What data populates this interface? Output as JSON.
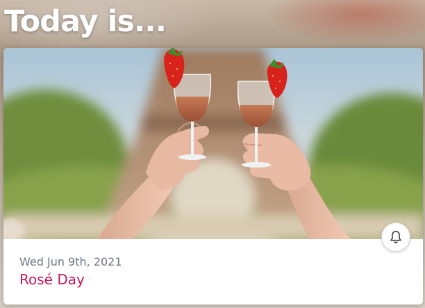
{
  "header": {
    "title": "Today is..."
  },
  "event_card": {
    "date": "Wed Jun 9th, 2021",
    "name": "Rosé Day",
    "photo_subject": "Two hands toasting glasses of rosé wine garnished with strawberries in front of the Eiffel Tower",
    "reminder_icon": "bell-icon"
  },
  "colors": {
    "title_text": "#ffffff",
    "date_text": "#6b7785",
    "event_name_text": "#c2185b",
    "card_background": "#ffffff"
  }
}
